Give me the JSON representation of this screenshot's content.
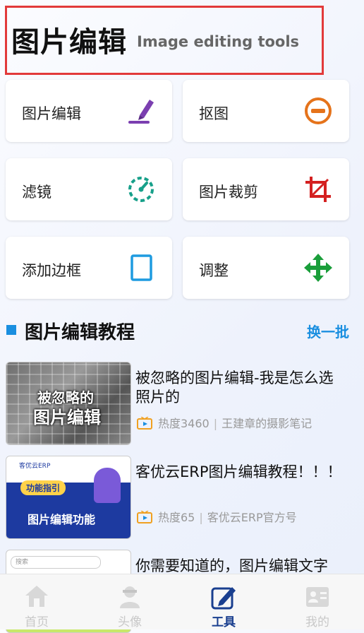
{
  "header": {
    "title": "图片编辑",
    "subtitle": "Image editing tools"
  },
  "tools": [
    {
      "label": "图片编辑",
      "icon": "pen-icon",
      "color": "#7b3fb0"
    },
    {
      "label": "抠图",
      "icon": "minus-circle-icon",
      "color": "#e5731b"
    },
    {
      "label": "滤镜",
      "icon": "speedometer-icon",
      "color": "#17a08a"
    },
    {
      "label": "图片裁剪",
      "icon": "crop-icon",
      "color": "#d42020"
    },
    {
      "label": "添加边框",
      "icon": "square-frame-icon",
      "color": "#1e9be0"
    },
    {
      "label": "调整",
      "icon": "move-arrows-icon",
      "color": "#1a9e3a"
    }
  ],
  "tutorials": {
    "title": "图片编辑教程",
    "refresh_label": "换一批",
    "items": [
      {
        "title": "被忽略的图片编辑-我是怎么选照片的",
        "heat": "热度3460",
        "author": "王建章的摄影笔记",
        "thumb_text_1": "被忽略的",
        "thumb_text_2": "图片编辑"
      },
      {
        "title": "客优云ERP图片编辑教程！！！",
        "heat": "热度65",
        "author": "客优云ERP官方号",
        "thumb_brand": "客优云ERP",
        "thumb_tag": "功能指引",
        "thumb_text": "图片编辑功能"
      },
      {
        "title": "你需要知道的，图片编辑文字",
        "thumb_search": "搜索"
      }
    ]
  },
  "tabbar": {
    "items": [
      {
        "label": "首页",
        "icon": "home-icon",
        "active": false
      },
      {
        "label": "头像",
        "icon": "avatar-icon",
        "active": false
      },
      {
        "label": "工具",
        "icon": "edit-icon",
        "active": true
      },
      {
        "label": "我的",
        "icon": "profile-card-icon",
        "active": false
      }
    ]
  },
  "colors": {
    "accent": "#1a8fe0",
    "highlight_border": "#e23a3a",
    "tab_active": "#1a3f8f"
  }
}
